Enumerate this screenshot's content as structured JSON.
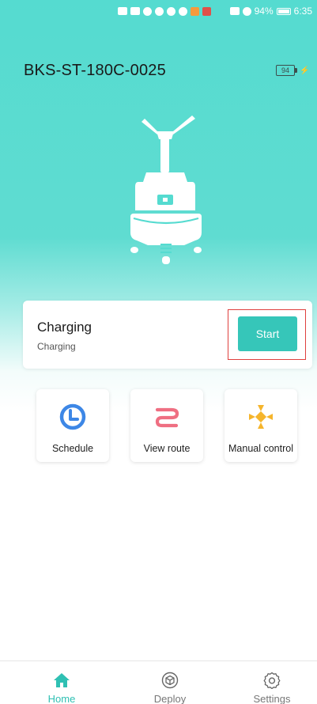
{
  "status_bar": {
    "battery_percent": "94%",
    "time": "6:35"
  },
  "device": {
    "name": "BKS-ST-180C-0025",
    "battery_level": "94"
  },
  "status_card": {
    "title": "Charging",
    "subtitle": "Charging",
    "start_label": "Start"
  },
  "actions": [
    {
      "label": "Schedule",
      "icon": "clock-icon",
      "color": "#3d87e6"
    },
    {
      "label": "View route",
      "icon": "route-icon",
      "color": "#ef6f82"
    },
    {
      "label": "Manual control",
      "icon": "dpad-icon",
      "color": "#f5b52c"
    }
  ],
  "nav": [
    {
      "label": "Home",
      "icon": "home-icon",
      "active": true
    },
    {
      "label": "Deploy",
      "icon": "cube-icon",
      "active": false
    },
    {
      "label": "Settings",
      "icon": "gear-icon",
      "active": false
    }
  ],
  "colors": {
    "accent": "#36c6b9",
    "highlight": "#e0403e",
    "background_top": "#55dbd0"
  }
}
